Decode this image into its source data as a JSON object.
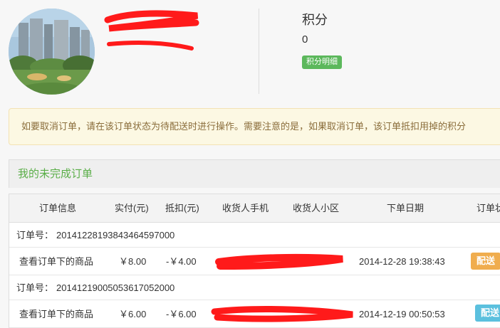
{
  "profile": {
    "points_title": "积分",
    "points_value": "0",
    "points_detail_button": "积分明细"
  },
  "notice": {
    "text": "如要取消订单，请在该订单状态为待配送时进行操作。需要注意的是，如果取消订单，该订单抵扣用掉的积分"
  },
  "section": {
    "title": "我的未完成订单"
  },
  "table": {
    "headers": [
      "订单信息",
      "实付(元)",
      "抵扣(元)",
      "收货人手机",
      "收货人小区",
      "下单日期",
      "订单状"
    ],
    "orders": [
      {
        "order_no_label": "订单号：",
        "order_no": "20141228193843464597000",
        "item_link": "查看订单下的商品",
        "paid": "￥8.00",
        "deduct": "-￥4.00",
        "date": "2014-12-28 19:38:43",
        "status": "配送",
        "status_color": "#f0ad4e"
      },
      {
        "order_no_label": "订单号：",
        "order_no": "20141219005053617052000",
        "item_link": "查看订单下的商品",
        "paid": "￥6.00",
        "deduct": "-￥6.00",
        "date": "2014-12-19 00:50:53",
        "status": "配送",
        "status_color": "#5bc0de"
      }
    ]
  },
  "colors": {
    "accent_green": "#5aae48",
    "button_green": "#5cb85c",
    "redaction_red": "#ff1a1a"
  }
}
